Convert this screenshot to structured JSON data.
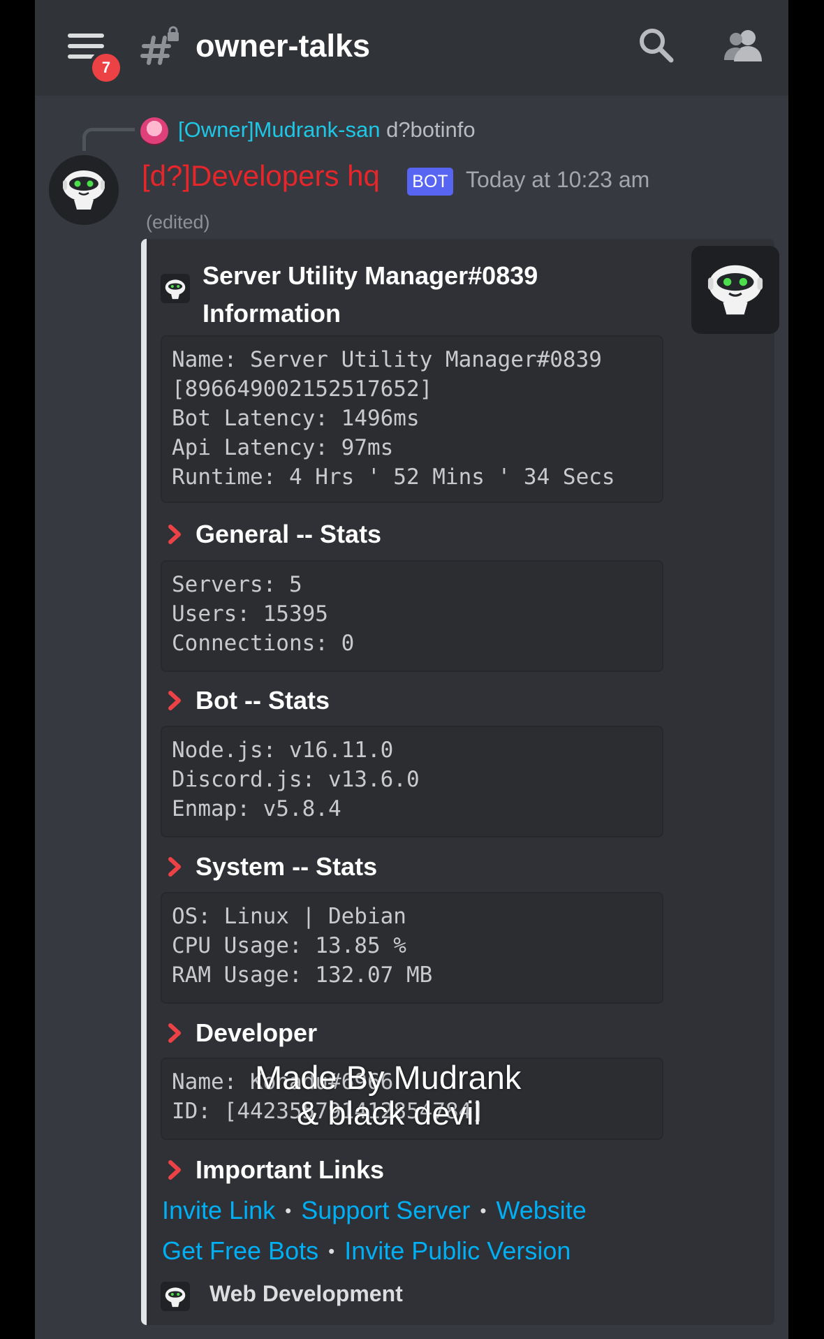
{
  "header": {
    "notification_count": "7",
    "channel_name": "owner-talks"
  },
  "reply": {
    "author": "[Owner]Mudrank-san",
    "command": "d?botinfo"
  },
  "message": {
    "author": "[d?]Developers hq",
    "bot_tag": "BOT",
    "timestamp": "Today at 10:23 am",
    "edited": "(edited)"
  },
  "embed": {
    "title_line1": "Server Utility Manager#0839",
    "title_line2": "Information",
    "info_block": "Name: Server Utility Manager#0839\n[896649002152517652]\nBot Latency: 1496ms\nApi Latency: 97ms\nRuntime: 4 Hrs ' 52 Mins ' 34 Secs",
    "fields": [
      {
        "title": "General -- Stats",
        "value": "Servers: 5\nUsers: 15395\nConnections: 0"
      },
      {
        "title": "Bot -- Stats",
        "value": "Node.js: v16.11.0\nDiscord.js: v13.6.0\nEnmap: v5.8.4"
      },
      {
        "title": "System -- Stats",
        "value": "OS: Linux | Debian\nCPU Usage: 13.85 %\nRAM Usage: 132.07 MB"
      },
      {
        "title": "Developer",
        "value": "Name: Konadu#6966\nID: [442355791412854784]"
      },
      {
        "title": "Important Links"
      }
    ],
    "links": {
      "invite": "Invite Link",
      "support": "Support Server",
      "website": "Website",
      "free_bots": "Get Free Bots",
      "invite_public": "Invite Public Version",
      "separator": "•"
    },
    "footer": "Web Development"
  },
  "watermark": {
    "line1": "Made By Mudrank",
    "line2": "& black devil"
  },
  "colors": {
    "bot_author": "#e5262a",
    "reply_author": "#1fc7e6",
    "link": "#00aff4",
    "bot_tag": "#5865f2",
    "badge": "#ed4245",
    "chevron": "#ed4245"
  },
  "icons": [
    "hamburger-menu-icon",
    "channel-locked-hash-icon",
    "search-icon",
    "members-icon",
    "bot-avatar-icon",
    "chevron-right-icon"
  ]
}
